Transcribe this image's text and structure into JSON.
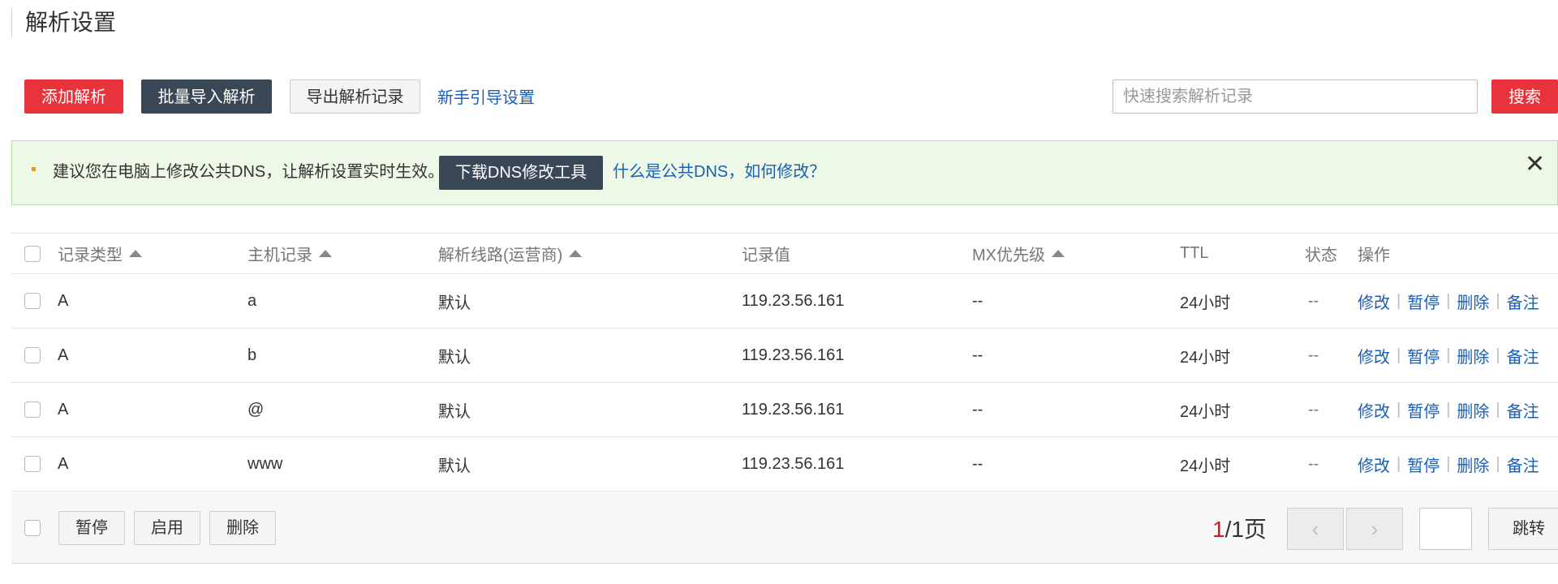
{
  "page": {
    "title": "解析设置"
  },
  "toolbar": {
    "add_label": "添加解析",
    "import_label": "批量导入解析",
    "export_label": "导出解析记录",
    "guide_label": "新手引导设置",
    "search_placeholder": "快速搜索解析记录",
    "search_label": "搜索"
  },
  "notice": {
    "text": "建议您在电脑上修改公共DNS，让解析设置实时生效。",
    "button_label": "下载DNS修改工具",
    "link_label": "什么是公共DNS，如何修改？",
    "close_glyph": "✕"
  },
  "table": {
    "columns": {
      "type": "记录类型",
      "host": "主机记录",
      "line": "解析线路(运营商)",
      "value": "记录值",
      "mx": "MX优先级",
      "ttl": "TTL",
      "status": "状态",
      "ops": "操作"
    },
    "actions": {
      "edit": "修改",
      "pause": "暂停",
      "delete": "删除",
      "note": "备注",
      "separator": "|"
    },
    "rows": [
      {
        "type": "A",
        "host": "a",
        "line": "默认",
        "value": "119.23.56.161",
        "mx": "--",
        "ttl": "24小时",
        "status": "--"
      },
      {
        "type": "A",
        "host": "b",
        "line": "默认",
        "value": "119.23.56.161",
        "mx": "--",
        "ttl": "24小时",
        "status": "--"
      },
      {
        "type": "A",
        "host": "@",
        "line": "默认",
        "value": "119.23.56.161",
        "mx": "--",
        "ttl": "24小时",
        "status": "--"
      },
      {
        "type": "A",
        "host": "www",
        "line": "默认",
        "value": "119.23.56.161",
        "mx": "--",
        "ttl": "24小时",
        "status": "--"
      }
    ]
  },
  "footer": {
    "pause_label": "暂停",
    "enable_label": "启用",
    "delete_label": "删除",
    "current_page": "1",
    "total_pages_text": "/1页",
    "prev_glyph": "‹",
    "next_glyph": "›",
    "jump_label": "跳转"
  },
  "colors": {
    "accent_red": "#e8333c",
    "dark_button": "#3a4756",
    "link_blue": "#1a5fb4",
    "notice_bg": "#edf9e6"
  }
}
